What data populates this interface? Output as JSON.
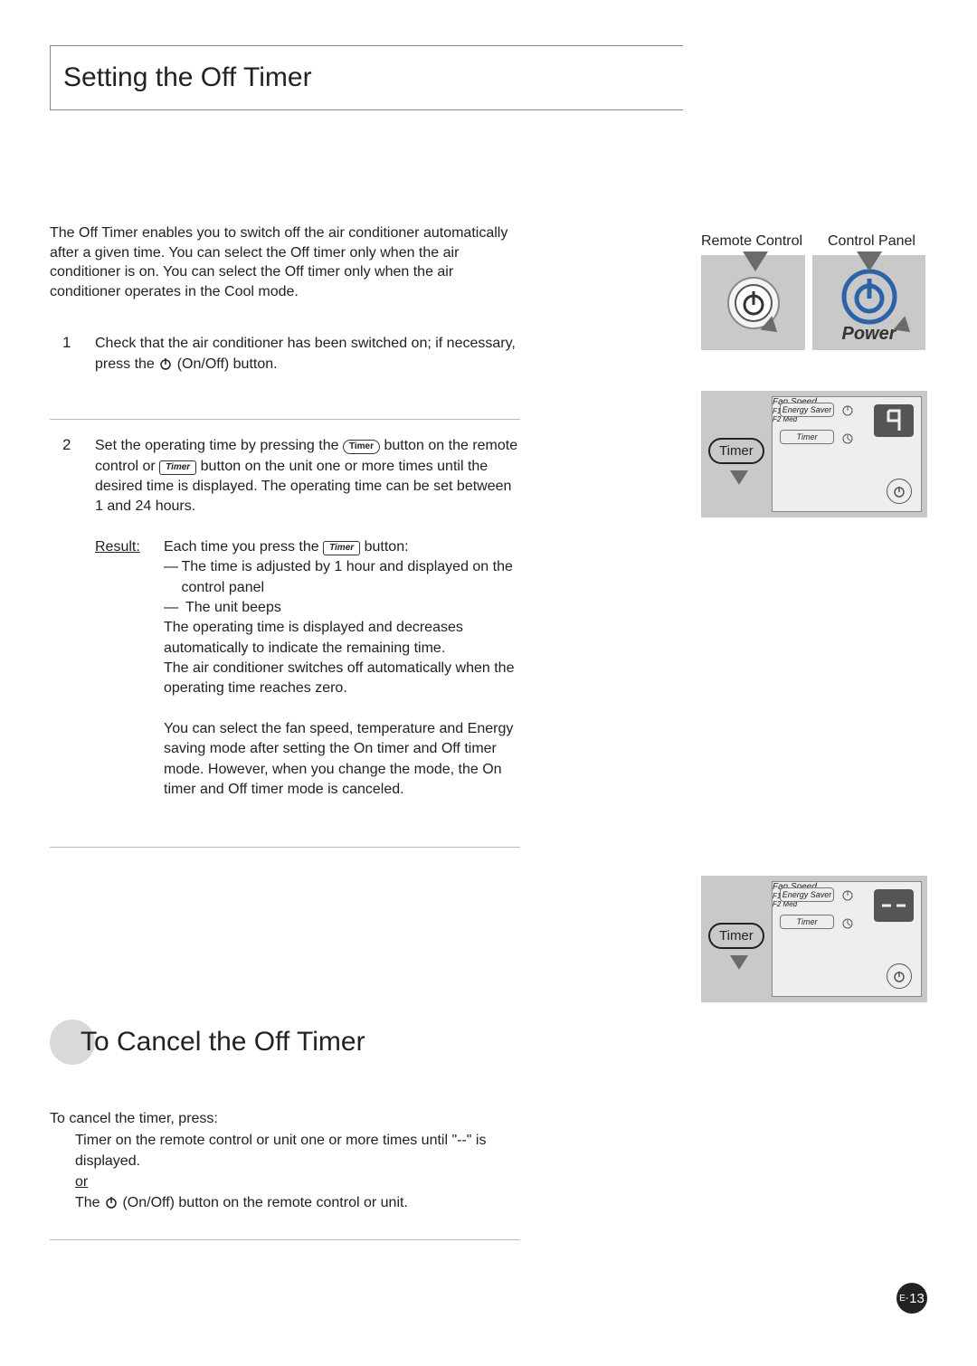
{
  "title": "Setting the Off Timer",
  "intro": "The Off Timer enables you to switch off the air conditioner automatically after a given time. You can select the Off timer only when the air conditioner is on. You can select the Off timer only when the air conditioner operates in the Cool mode.",
  "steps": [
    {
      "num": "1",
      "pre": "Check that the air conditioner has been switched on; if necessary, press the ",
      "post": " (On/Off) button."
    },
    {
      "num": "2",
      "pre": "Set the operating time by pressing the ",
      "mid1": " button on the remote control or ",
      "mid2": " button on the unit one or more times until the desired time is displayed. The operating time can be set between 1 and 24 hours.",
      "result_label": "Result:",
      "result_lead": "Each time you press the ",
      "result_tail": " button:",
      "bullets": [
        "The time is adjusted by 1 hour and displayed on the control panel",
        "The unit beeps"
      ],
      "after_bullets": [
        "The operating time is displayed and decreases automatically to indicate the remaining time.",
        "The air conditioner switches off automatically when the operating time reaches zero."
      ],
      "note": "You can select the fan speed, temperature and Energy saving mode after setting the On timer and Off timer mode. However, when you change the mode, the On timer and Off timer mode is canceled."
    }
  ],
  "section2_title": "To Cancel the Off Timer",
  "cancel": {
    "lead": "To cancel the timer, press:",
    "line1": "Timer on the remote control or unit one or more times until \"--\" is displayed.",
    "or": "or",
    "line2_pre": "The ",
    "line2_post": " (On/Off) button on the remote control or unit."
  },
  "fig1": {
    "label_remote": "Remote Control",
    "label_panel": "Control Panel",
    "power_label": "Power"
  },
  "panel": {
    "energy_saver": "Energy Saver",
    "timer": "Timer",
    "fan_speed": "Fan Speed",
    "f1": "F1 Low",
    "f2": "F2 Med",
    "timer_pill": "Timer"
  },
  "inline_labels": {
    "timer_pill": "Timer",
    "timer_rect": "Timer"
  },
  "page_num_prefix": "E-",
  "page_num": "13"
}
